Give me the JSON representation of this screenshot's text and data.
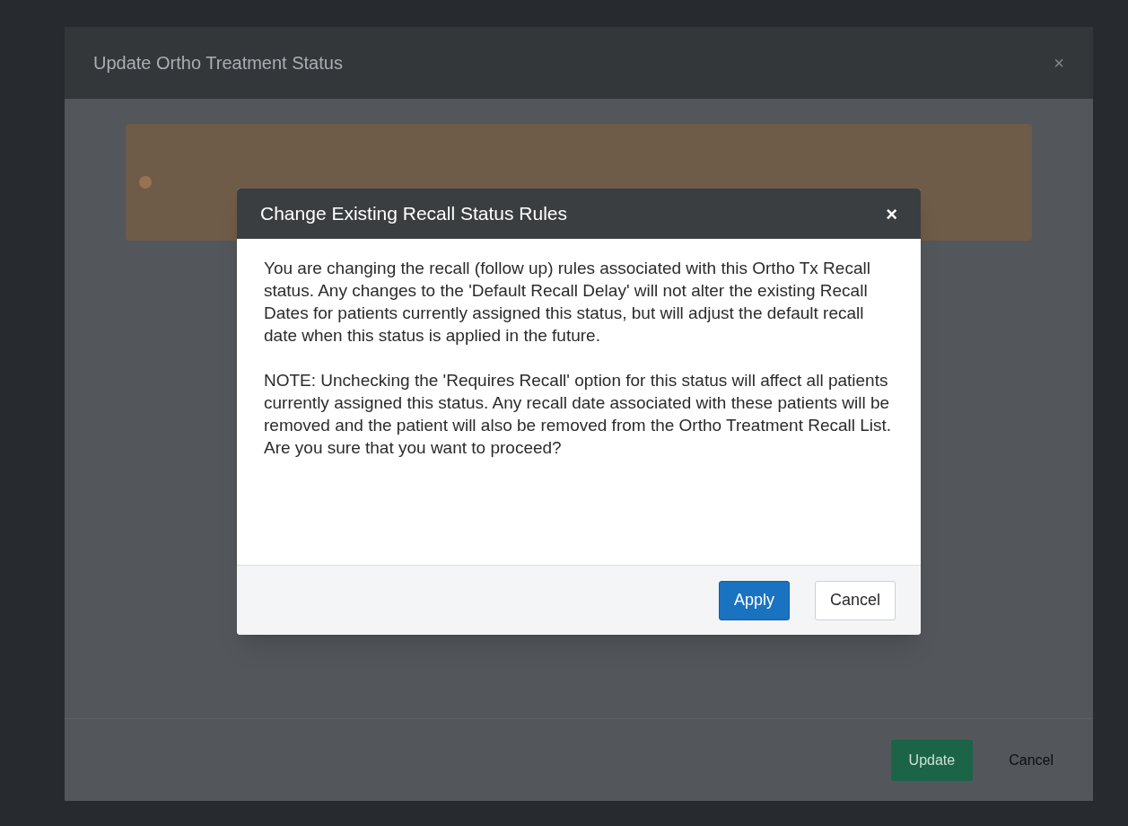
{
  "background_dialog": {
    "title": "Update Ortho Treatment Status",
    "close": "×",
    "buttons": [
      {
        "label": "Update",
        "kind": "primary"
      },
      {
        "label": "Cancel",
        "kind": "link"
      }
    ]
  },
  "dialog": {
    "title": "Change Existing Recall Status Rules",
    "close": "×",
    "paragraphs": [
      "You are changing the recall (follow up) rules associated with this Ortho Tx Recall status. Any changes to the 'Default Recall Delay' will not alter the existing Recall Dates for patients currently assigned this status, but will adjust the default recall date when this status is applied in the future.",
      "NOTE: Unchecking the 'Requires Recall' option for this status will affect all patients currently assigned this status. Any recall date associated with these patients will be removed and the patient will also be removed from the Ortho Treatment Recall List. Are you sure that you want to proceed?"
    ],
    "buttons": [
      {
        "label": "Apply",
        "kind": "primary"
      },
      {
        "label": "Cancel",
        "kind": "default"
      }
    ]
  }
}
